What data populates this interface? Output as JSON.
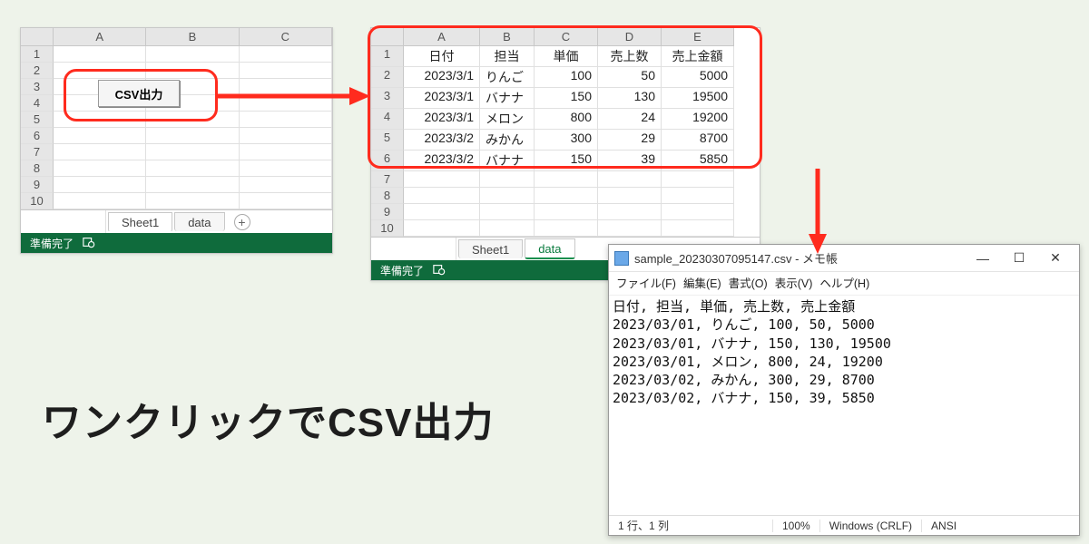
{
  "headline": "ワンクリックでCSV出力",
  "excel1": {
    "cols": [
      "A",
      "B",
      "C"
    ],
    "rows": [
      "1",
      "2",
      "3",
      "4",
      "5",
      "6",
      "7",
      "8",
      "9",
      "10"
    ],
    "csv_button": "CSV出力",
    "tabs": {
      "sheet1": "Sheet1",
      "data": "data"
    },
    "status": "準備完了"
  },
  "excel2": {
    "cols": [
      "A",
      "B",
      "C",
      "D",
      "E"
    ],
    "rows": [
      "1",
      "2",
      "3",
      "4",
      "5",
      "6",
      "7",
      "8",
      "9",
      "10"
    ],
    "headers": [
      "日付",
      "担当",
      "単価",
      "売上数",
      "売上金額"
    ],
    "data": [
      [
        "2023/3/1",
        "りんご",
        "100",
        "50",
        "5000"
      ],
      [
        "2023/3/1",
        "バナナ",
        "150",
        "130",
        "19500"
      ],
      [
        "2023/3/1",
        "メロン",
        "800",
        "24",
        "19200"
      ],
      [
        "2023/3/2",
        "みかん",
        "300",
        "29",
        "8700"
      ],
      [
        "2023/3/2",
        "バナナ",
        "150",
        "39",
        "5850"
      ]
    ],
    "tabs": {
      "sheet1": "Sheet1",
      "data": "data"
    },
    "status": "準備完了"
  },
  "notepad": {
    "title": "sample_20230307095147.csv - メモ帳",
    "menu": {
      "file": "ファイル(F)",
      "edit": "編集(E)",
      "format": "書式(O)",
      "view": "表示(V)",
      "help": "ヘルプ(H)"
    },
    "body": "日付, 担当, 単価, 売上数, 売上金額\n2023/03/01, りんご, 100, 50, 5000\n2023/03/01, バナナ, 150, 130, 19500\n2023/03/01, メロン, 800, 24, 19200\n2023/03/02, みかん, 300, 29, 8700\n2023/03/02, バナナ, 150, 39, 5850",
    "status": {
      "pos": "1 行、1 列",
      "zoom": "100%",
      "eol": "Windows (CRLF)",
      "enc": "ANSI"
    },
    "winbtns": {
      "min": "—",
      "max": "☐",
      "close": "✕"
    }
  }
}
